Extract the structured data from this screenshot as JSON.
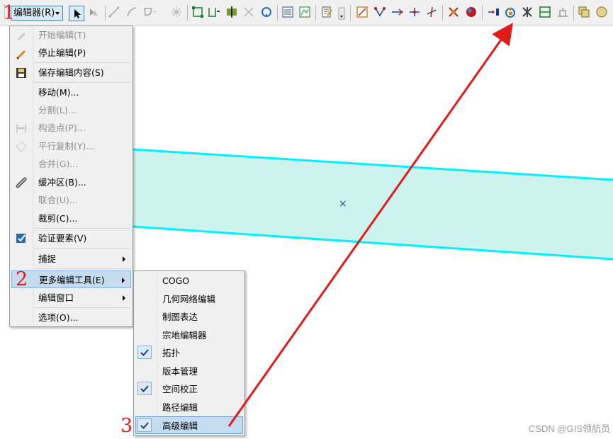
{
  "toolbar": {
    "editor_label": "编辑器(R)"
  },
  "editor_menu": {
    "items": [
      {
        "label": "开始编辑(T)",
        "disabled": true,
        "icon": "pencil-icon"
      },
      {
        "label": "停止编辑(P)",
        "disabled": false,
        "icon": "stop-pencil-icon"
      },
      {
        "label": "保存编辑内容(S)",
        "disabled": false,
        "icon": "save-disk-icon"
      },
      {
        "label": "移动(M)...",
        "disabled": false
      },
      {
        "label": "分割(L)...",
        "disabled": true
      },
      {
        "label": "构造点(P)...",
        "disabled": true,
        "icon": "construct-points-icon"
      },
      {
        "label": "平行复制(Y)...",
        "disabled": true,
        "icon": "copy-parallel-icon"
      },
      {
        "label": "合并(G)...",
        "disabled": true
      },
      {
        "label": "缓冲区(B)...",
        "disabled": false,
        "icon": "buffer-icon"
      },
      {
        "label": "联合(U)...",
        "disabled": true
      },
      {
        "label": "裁剪(C)...",
        "disabled": false
      },
      {
        "label": "验证要素(V)",
        "disabled": false,
        "icon": "validate-features-icon"
      },
      {
        "label": "捕捉",
        "disabled": false,
        "submenu": true
      },
      {
        "label": "更多编辑工具(E)",
        "disabled": false,
        "submenu": true,
        "highlighted": true
      },
      {
        "label": "编辑窗口",
        "disabled": false,
        "submenu": true
      },
      {
        "label": "选项(O)...",
        "disabled": false
      }
    ]
  },
  "more_tools_menu": {
    "items": [
      {
        "label": "COGO",
        "checked": false
      },
      {
        "label": "几何网络编辑",
        "checked": false
      },
      {
        "label": "制图表达",
        "checked": false
      },
      {
        "label": "宗地编辑器",
        "checked": false
      },
      {
        "label": "拓扑",
        "checked": true
      },
      {
        "label": "版本管理",
        "checked": false
      },
      {
        "label": "空间校正",
        "checked": true
      },
      {
        "label": "路径编辑",
        "checked": false
      },
      {
        "label": "高级编辑",
        "checked": true,
        "highlighted": true
      }
    ]
  },
  "annotations": {
    "step1": "1",
    "step2": "2",
    "step3": "3",
    "arrow_color": "#e21a1a"
  },
  "map": {
    "polygon_fill": "#cdf3ee",
    "polygon_outline": "#00f0ff",
    "center_marker": "×"
  },
  "watermark": "CSDN @GIS领航员"
}
